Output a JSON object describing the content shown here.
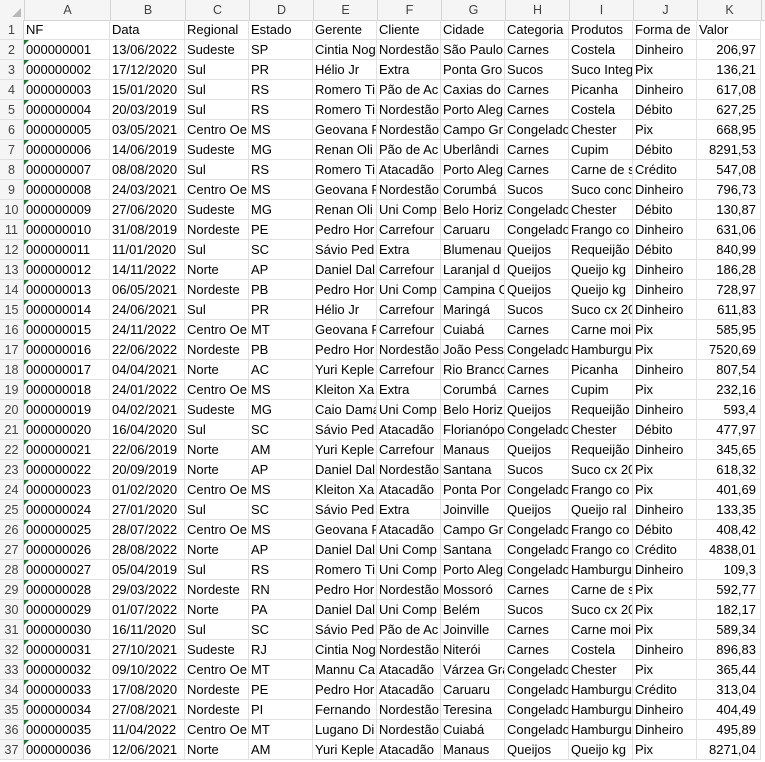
{
  "columns": [
    "A",
    "B",
    "C",
    "D",
    "E",
    "F",
    "G",
    "H",
    "I",
    "J",
    "K"
  ],
  "header": [
    "NF",
    "Data",
    "Regional",
    "Estado",
    "Gerente",
    "Cliente",
    "Cidade",
    "Categoria",
    "Produtos",
    "Forma de",
    "Valor"
  ],
  "rows": [
    [
      "000000001",
      "13/06/2022",
      "Sudeste",
      "SP",
      "Cintia Nog",
      "Nordestão",
      "São Paulo",
      "Carnes",
      "Costela",
      "Dinheiro",
      "206,97"
    ],
    [
      "000000002",
      "17/12/2020",
      "Sul",
      "PR",
      "Hélio Jr",
      "Extra",
      "Ponta Gro",
      "Sucos",
      "Suco Integ",
      "Pix",
      "136,21"
    ],
    [
      "000000003",
      "15/01/2020",
      "Sul",
      "RS",
      "Romero Ti",
      "Pão de Ac",
      "Caxias do",
      "Carnes",
      "Picanha",
      "Dinheiro",
      "617,08"
    ],
    [
      "000000004",
      "20/03/2019",
      "Sul",
      "RS",
      "Romero Ti",
      "Nordestão",
      "Porto Aleg",
      "Carnes",
      "Costela",
      "Débito",
      "627,25"
    ],
    [
      "000000005",
      "03/05/2021",
      "Centro Oe",
      "MS",
      "Geovana F",
      "Nordestão",
      "Campo Gr",
      "Congelado",
      "Chester",
      "Pix",
      "668,95"
    ],
    [
      "000000006",
      "14/06/2019",
      "Sudeste",
      "MG",
      "Renan Oli",
      "Pão de Ac",
      "Uberlândi",
      "Carnes",
      "Cupim",
      "Débito",
      "8291,53"
    ],
    [
      "000000007",
      "08/08/2020",
      "Sul",
      "RS",
      "Romero Ti",
      "Atacadão",
      "Porto Aleg",
      "Carnes",
      "Carne de s",
      "Crédito",
      "547,08"
    ],
    [
      "000000008",
      "24/03/2021",
      "Centro Oe",
      "MS",
      "Geovana F",
      "Nordestão",
      "Corumbá",
      "Sucos",
      "Suco conc",
      "Dinheiro",
      "796,73"
    ],
    [
      "000000009",
      "27/06/2020",
      "Sudeste",
      "MG",
      "Renan Oli",
      "Uni Comp",
      "Belo Horiz",
      "Congelado",
      "Chester",
      "Débito",
      "130,87"
    ],
    [
      "000000010",
      "31/08/2019",
      "Nordeste",
      "PE",
      "Pedro Hor",
      "Carrefour",
      "Caruaru",
      "Congelado",
      "Frango co",
      "Dinheiro",
      "631,06"
    ],
    [
      "000000011",
      "11/01/2020",
      "Sul",
      "SC",
      "Sávio Ped",
      "Extra",
      "Blumenau",
      "Queijos",
      "Requeijão",
      "Débito",
      "840,99"
    ],
    [
      "000000012",
      "14/11/2022",
      "Norte",
      "AP",
      "Daniel Dal",
      "Carrefour",
      "Laranjal d",
      "Queijos",
      "Queijo kg",
      "Dinheiro",
      "186,28"
    ],
    [
      "000000013",
      "06/05/2021",
      "Nordeste",
      "PB",
      "Pedro Hor",
      "Uni Comp",
      "Campina G",
      "Queijos",
      "Queijo kg",
      "Dinheiro",
      "728,97"
    ],
    [
      "000000014",
      "24/06/2021",
      "Sul",
      "PR",
      "Hélio Jr",
      "Carrefour",
      "Maringá",
      "Sucos",
      "Suco cx 20",
      "Dinheiro",
      "611,83"
    ],
    [
      "000000015",
      "24/11/2022",
      "Centro Oe",
      "MT",
      "Geovana F",
      "Carrefour",
      "Cuiabá",
      "Carnes",
      "Carne moi",
      "Pix",
      "585,95"
    ],
    [
      "000000016",
      "22/06/2022",
      "Nordeste",
      "PB",
      "Pedro Hor",
      "Nordestão",
      "João Pess",
      "Congelado",
      "Hamburgu",
      "Pix",
      "7520,69"
    ],
    [
      "000000017",
      "04/04/2021",
      "Norte",
      "AC",
      "Yuri Keple",
      "Carrefour",
      "Rio Branco",
      "Carnes",
      "Picanha",
      "Dinheiro",
      "807,54"
    ],
    [
      "000000018",
      "24/01/2022",
      "Centro Oe",
      "MS",
      "Kleiton Xa",
      "Extra",
      "Corumbá",
      "Carnes",
      "Cupim",
      "Pix",
      "232,16"
    ],
    [
      "000000019",
      "04/02/2021",
      "Sudeste",
      "MG",
      "Caio Dama",
      "Uni Comp",
      "Belo Horiz",
      "Queijos",
      "Requeijão",
      "Dinheiro",
      "593,4"
    ],
    [
      "000000020",
      "16/04/2020",
      "Sul",
      "SC",
      "Sávio Ped",
      "Atacadão",
      "Florianópo",
      "Congelado",
      "Chester",
      "Débito",
      "477,97"
    ],
    [
      "000000021",
      "22/06/2019",
      "Norte",
      "AM",
      "Yuri Keple",
      "Carrefour",
      "Manaus",
      "Queijos",
      "Requeijão",
      "Dinheiro",
      "345,65"
    ],
    [
      "000000022",
      "20/09/2019",
      "Norte",
      "AP",
      "Daniel Dal",
      "Nordestão",
      "Santana",
      "Sucos",
      "Suco cx 20",
      "Pix",
      "618,32"
    ],
    [
      "000000023",
      "01/02/2020",
      "Centro Oe",
      "MS",
      "Kleiton Xa",
      "Atacadão",
      "Ponta Por",
      "Congelado",
      "Frango co",
      "Pix",
      "401,69"
    ],
    [
      "000000024",
      "27/01/2020",
      "Sul",
      "SC",
      "Sávio Ped",
      "Extra",
      "Joinville",
      "Queijos",
      "Queijo ral",
      "Dinheiro",
      "133,35"
    ],
    [
      "000000025",
      "28/07/2022",
      "Centro Oe",
      "MS",
      "Geovana F",
      "Atacadão",
      "Campo Gr",
      "Congelado",
      "Frango co",
      "Débito",
      "408,42"
    ],
    [
      "000000026",
      "28/08/2022",
      "Norte",
      "AP",
      "Daniel Dal",
      "Uni Comp",
      "Santana",
      "Congelado",
      "Frango co",
      "Crédito",
      "4838,01"
    ],
    [
      "000000027",
      "05/04/2019",
      "Sul",
      "RS",
      "Romero Ti",
      "Uni Comp",
      "Porto Aleg",
      "Congelado",
      "Hamburgu",
      "Dinheiro",
      "109,3"
    ],
    [
      "000000028",
      "29/03/2022",
      "Nordeste",
      "RN",
      "Pedro Hor",
      "Nordestão",
      "Mossoró",
      "Carnes",
      "Carne de s",
      "Pix",
      "592,77"
    ],
    [
      "000000029",
      "01/07/2022",
      "Norte",
      "PA",
      "Daniel Dal",
      "Uni Comp",
      "Belém",
      "Sucos",
      "Suco cx 20",
      "Pix",
      "182,17"
    ],
    [
      "000000030",
      "16/11/2020",
      "Sul",
      "SC",
      "Sávio Ped",
      "Pão de Ac",
      "Joinville",
      "Carnes",
      "Carne moi",
      "Pix",
      "589,34"
    ],
    [
      "000000031",
      "27/10/2021",
      "Sudeste",
      "RJ",
      "Cintia Nog",
      "Nordestão",
      "Niterói",
      "Carnes",
      "Costela",
      "Dinheiro",
      "896,83"
    ],
    [
      "000000032",
      "09/10/2022",
      "Centro Oe",
      "MT",
      "Mannu Ca",
      "Atacadão",
      "Várzea Gra",
      "Congelado",
      "Chester",
      "Pix",
      "365,44"
    ],
    [
      "000000033",
      "17/08/2020",
      "Nordeste",
      "PE",
      "Pedro Hor",
      "Atacadão",
      "Caruaru",
      "Congelado",
      "Hamburgu",
      "Crédito",
      "313,04"
    ],
    [
      "000000034",
      "27/08/2021",
      "Nordeste",
      "PI",
      "Fernando",
      "Nordestão",
      "Teresina",
      "Congelado",
      "Hamburgu",
      "Dinheiro",
      "404,49"
    ],
    [
      "000000035",
      "11/04/2022",
      "Centro Oe",
      "MT",
      "Lugano Di",
      "Nordestão",
      "Cuiabá",
      "Congelado",
      "Hamburgu",
      "Dinheiro",
      "495,89"
    ],
    [
      "000000036",
      "12/06/2021",
      "Norte",
      "AM",
      "Yuri Keple",
      "Atacadão",
      "Manaus",
      "Queijos",
      "Queijo kg",
      "Pix",
      "8271,04"
    ]
  ]
}
